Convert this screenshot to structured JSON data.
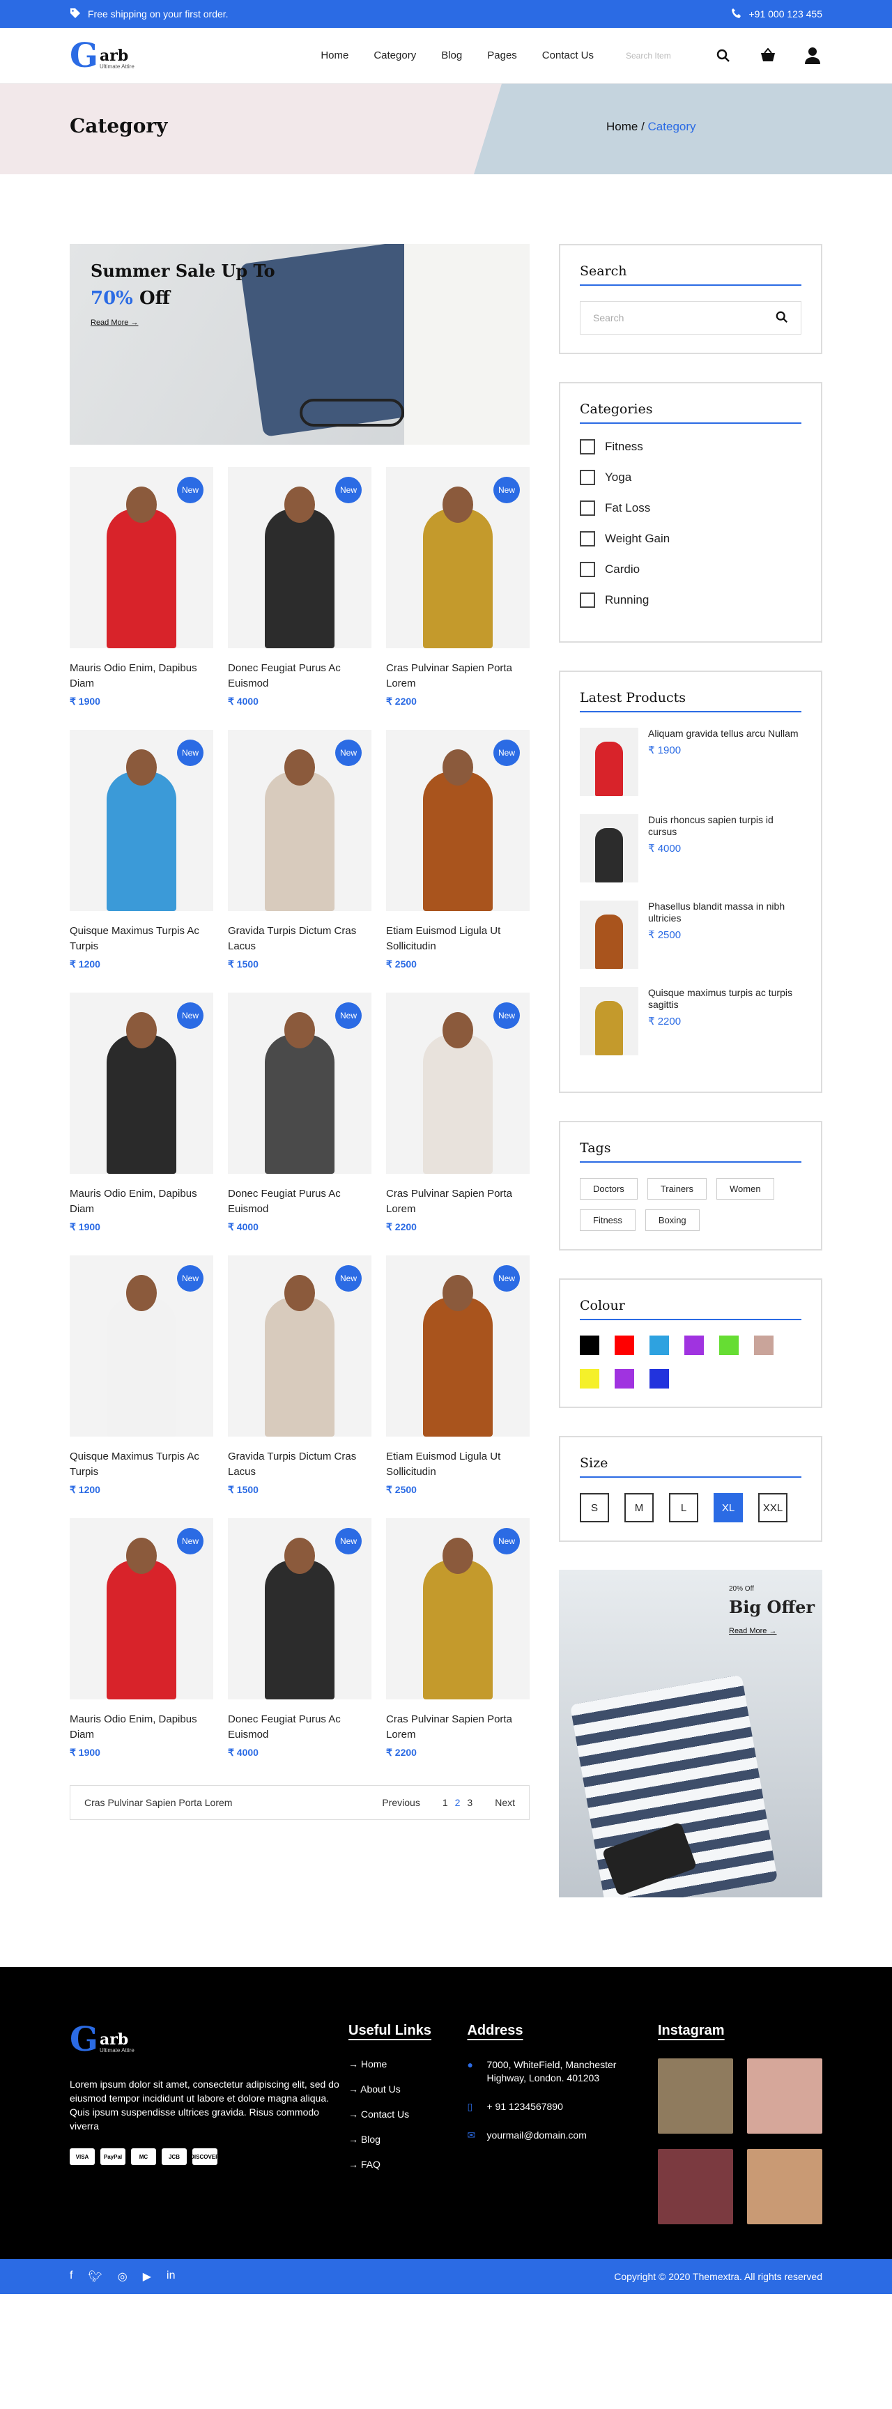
{
  "topbar": {
    "shipping": "Free shipping on your first order.",
    "phone": "+91 000 123 455"
  },
  "header": {
    "logo_letter": "G",
    "logo_word": "arb",
    "logo_sub": "Ultimate Attire",
    "nav": [
      "Home",
      "Category",
      "Blog",
      "Pages",
      "Contact Us"
    ],
    "search_placeholder": "Search Item"
  },
  "banner": {
    "title": "Category",
    "crumb_home": "Home",
    "crumb_sep": " / ",
    "crumb_current": "Category"
  },
  "promo": {
    "line1": "Summer Sale Up To",
    "pct": "70%",
    "off": " Off",
    "read_more": "Read More"
  },
  "badge": "New",
  "products": [
    {
      "name": "Mauris Odio Enim, Dapibus Diam",
      "price": "₹ 1900",
      "color": "#d8232a"
    },
    {
      "name": "Donec Feugiat Purus Ac Euismod",
      "price": "₹ 4000",
      "color": "#2c2c2c"
    },
    {
      "name": "Cras Pulvinar Sapien Porta Lorem",
      "price": "₹ 2200",
      "color": "#c49a2c"
    },
    {
      "name": "Quisque Maximus Turpis Ac Turpis",
      "price": "₹ 1200",
      "color": "#3b9ad8"
    },
    {
      "name": "Gravida Turpis Dictum Cras Lacus",
      "price": "₹ 1500",
      "color": "#d8cbbd"
    },
    {
      "name": "Etiam Euismod Ligula Ut Sollicitudin",
      "price": "₹ 2500",
      "color": "#a9541d"
    },
    {
      "name": "Mauris Odio Enim, Dapibus Diam",
      "price": "₹ 1900",
      "color": "#2a2a2a"
    },
    {
      "name": "Donec Feugiat Purus Ac Euismod",
      "price": "₹ 4000",
      "color": "#4a4a4a"
    },
    {
      "name": "Cras Pulvinar Sapien Porta Lorem",
      "price": "₹ 2200",
      "color": "#e8e2dc"
    },
    {
      "name": "Quisque Maximus Turpis Ac Turpis",
      "price": "₹ 1200",
      "color": "#f2f2f2"
    },
    {
      "name": "Gravida Turpis Dictum Cras Lacus",
      "price": "₹ 1500",
      "color": "#d8cbbd"
    },
    {
      "name": "Etiam Euismod Ligula Ut Sollicitudin",
      "price": "₹ 2500",
      "color": "#a9541d"
    },
    {
      "name": "Mauris Odio Enim, Dapibus Diam",
      "price": "₹ 1900",
      "color": "#d8232a"
    },
    {
      "name": "Donec Feugiat Purus Ac Euismod",
      "price": "₹ 4000",
      "color": "#2c2c2c"
    },
    {
      "name": "Cras Pulvinar Sapien Porta Lorem",
      "price": "₹ 2200",
      "color": "#c49a2c"
    }
  ],
  "pager": {
    "label": "Cras Pulvinar Sapien Porta Lorem",
    "prev": "Previous",
    "pages": [
      "1",
      "2",
      "3"
    ],
    "current": "2",
    "next": "Next"
  },
  "sidebar": {
    "search": {
      "title": "Search",
      "placeholder": "Search"
    },
    "categories": {
      "title": "Categories",
      "items": [
        "Fitness",
        "Yoga",
        "Fat Loss",
        "Weight Gain",
        "Cardio",
        "Running"
      ]
    },
    "latest": {
      "title": "Latest Products",
      "items": [
        {
          "name": "Aliquam gravida tellus arcu Nullam",
          "price": "₹ 1900",
          "color": "#d8232a"
        },
        {
          "name": "Duis rhoncus sapien turpis id cursus",
          "price": "₹ 4000",
          "color": "#2c2c2c"
        },
        {
          "name": "Phasellus blandit massa in nibh ultricies",
          "price": "₹ 2500",
          "color": "#a9541d"
        },
        {
          "name": "Quisque maximus turpis ac turpis sagittis",
          "price": "₹ 2200",
          "color": "#c49a2c"
        }
      ]
    },
    "tags": {
      "title": "Tags",
      "items": [
        "Doctors",
        "Trainers",
        "Women",
        "Fitness",
        "Boxing"
      ]
    },
    "colour": {
      "title": "Colour",
      "swatches": [
        "#000000",
        "#ff0000",
        "#2ea2e0",
        "#a033e0",
        "#66dd33",
        "#c9a49a",
        "#f5f02a",
        "#a033e0",
        "#2233dd"
      ]
    },
    "size": {
      "title": "Size",
      "items": [
        "S",
        "M",
        "L",
        "XL",
        "XXL"
      ],
      "selected": "XL"
    },
    "offer": {
      "small": "20% Off",
      "big": "Big Offer",
      "read_more": "Read More"
    }
  },
  "footer": {
    "about": "Lorem ipsum dolor sit amet, consectetur adipiscing elit, sed do eiusmod tempor incididunt ut labore et dolore magna aliqua. Quis ipsum suspendisse ultrices gravida. Risus commodo viverra",
    "cards": [
      "VISA",
      "PayPal",
      "MC",
      "JCB",
      "DISCOVER"
    ],
    "links_title": "Useful Links",
    "links": [
      "Home",
      "About Us",
      "Contact Us",
      "Blog",
      "FAQ"
    ],
    "address_title": "Address",
    "address": "7000, WhiteField, Manchester Highway, London. 401203",
    "phone": "+ 91 1234567890",
    "email": "yourmail@domain.com",
    "instagram_title": "Instagram",
    "insta_colors": [
      "#8f7b5e",
      "#d6a79a",
      "#7b3a40",
      "#c99a74"
    ],
    "copyright": "Copyright © 2020 Themextra. All rights reserved"
  }
}
